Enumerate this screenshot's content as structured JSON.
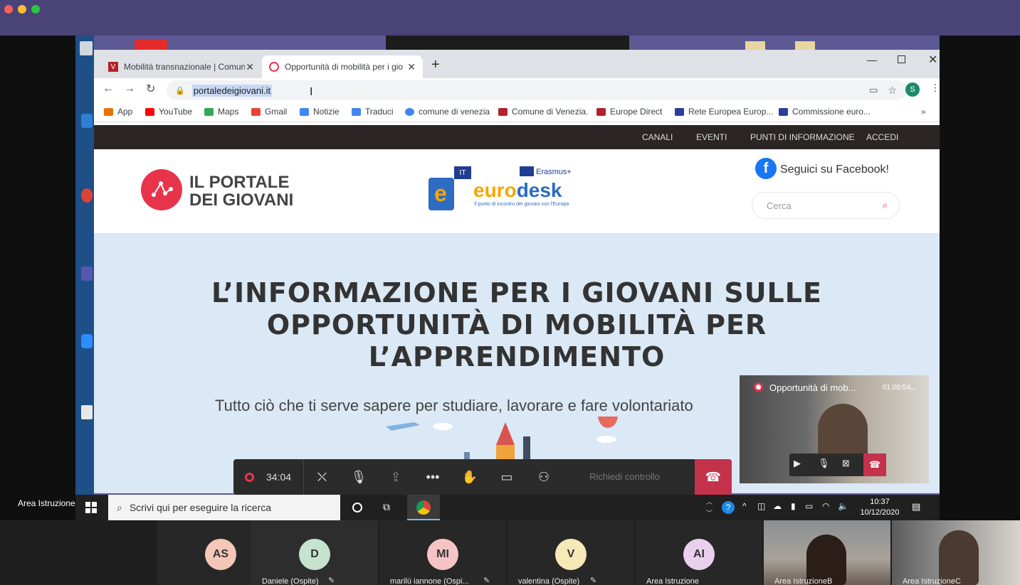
{
  "tabs": [
    {
      "title": "Mobilità transnazionale | Comun",
      "active": false
    },
    {
      "title": "Opportunità di mobilità per i gio",
      "active": true
    }
  ],
  "address": {
    "url": "portaledeigiovani.it"
  },
  "bookmarks": [
    {
      "label": "App",
      "color": "#e8710a"
    },
    {
      "label": "YouTube",
      "color": "#ff0000"
    },
    {
      "label": "Maps",
      "color": "#34a853"
    },
    {
      "label": "Gmail",
      "color": "#ea4335"
    },
    {
      "label": "Notizie",
      "color": "#4285f4"
    },
    {
      "label": "Traduci",
      "color": "#4285f4"
    },
    {
      "label": "comune di venezia",
      "color": "#4285f4"
    },
    {
      "label": "Comune di Venezia.",
      "color": "#b3212a"
    },
    {
      "label": "Europe Direct",
      "color": "#b3212a"
    },
    {
      "label": "Rete Europea Europ...",
      "color": "#2a3d9a"
    },
    {
      "label": "Commissione euro...",
      "color": "#2a3d9a"
    }
  ],
  "site": {
    "nav": [
      "CANALI",
      "EVENTI",
      "PUNTI DI INFORMAZIONE",
      "ACCEDI"
    ],
    "logo_line1": "IL PORTALE",
    "logo_line2": "DEI GIOVANI",
    "eurodesk_badge": "IT",
    "erasmus_label": "Erasmus+",
    "eurodesk_name_a": "euro",
    "eurodesk_name_b": "desk",
    "eurodesk_tagline": "Il punto di incontro dei giovani con l'Europa",
    "facebook_label": "Seguici su Facebook!",
    "search_placeholder": "Cerca",
    "hero_title_lines": [
      "L’informazione per i giovani sulle",
      "opportunità di mobilità per",
      "l’apprendimento"
    ],
    "hero_subtitle": "Tutto ciò che ti serve sapere per studiare, lavorare e fare volontariato"
  },
  "meeting": {
    "timer": "34:04",
    "request_control": "Richiedi controllo",
    "pip_title": "Opportunità di mob...",
    "pip_timer": "01:00:54"
  },
  "taskbar": {
    "search_placeholder": "Scrivi qui per eseguire la ricerca",
    "time": "10:37",
    "date": "10/12/2020"
  },
  "participants": [
    {
      "initials": "AS",
      "color": "#f4c7b8",
      "name": ""
    },
    {
      "initials": "D",
      "color": "#c5e3cf",
      "name": "Daniele (Ospite)"
    },
    {
      "initials": "MI",
      "color": "#f6c4c4",
      "name": "marilù iannone (Ospi..."
    },
    {
      "initials": "V",
      "color": "#f7e8b8",
      "name": "valentina (Ospite)"
    },
    {
      "initials": "AI",
      "color": "#ead0ee",
      "name": "Area Istruzione"
    }
  ],
  "video_tiles": [
    "Area IstruzioneB",
    "Area IstruzioneC"
  ],
  "presenter_label": "Area IstruzioneB"
}
